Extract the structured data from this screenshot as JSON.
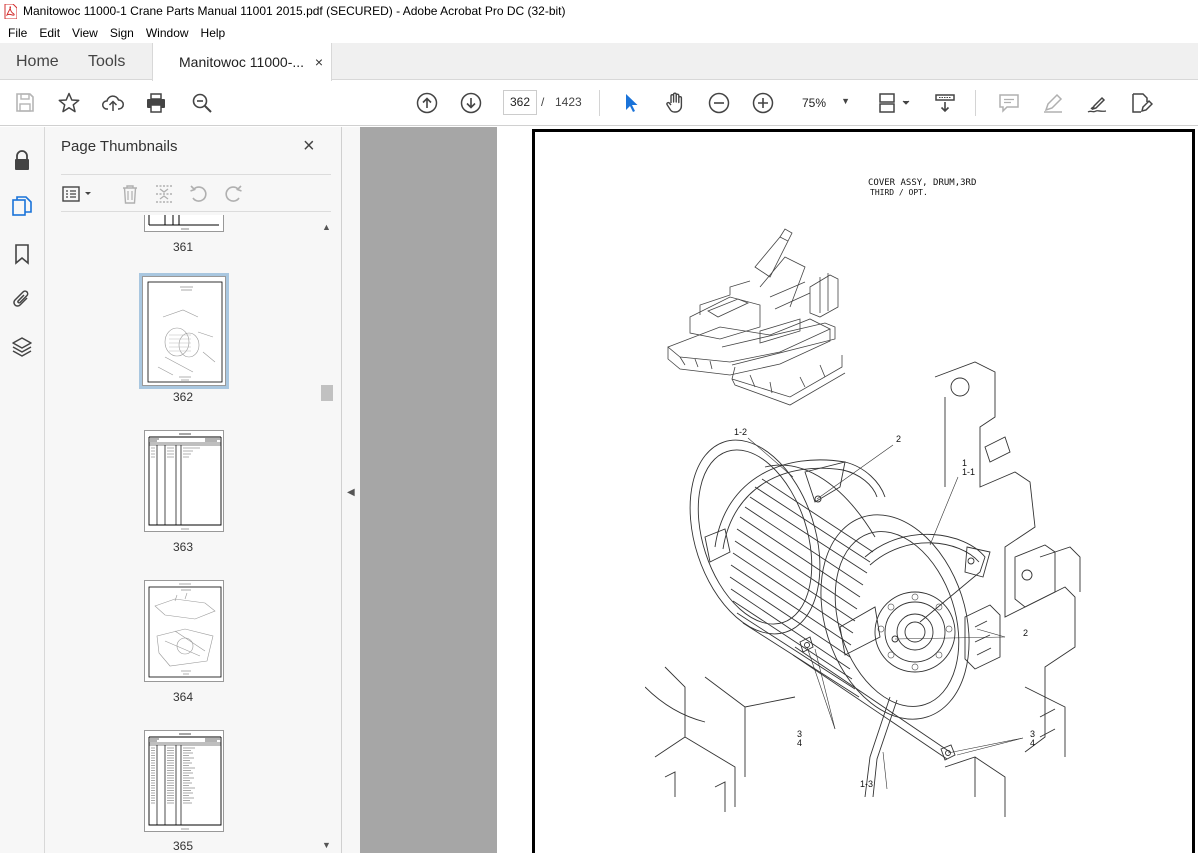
{
  "window": {
    "title": "Manitowoc 11000-1 Crane Parts Manual 11001 2015.pdf (SECURED) - Adobe Acrobat Pro DC (32-bit)"
  },
  "menu": [
    "File",
    "Edit",
    "View",
    "Sign",
    "Window",
    "Help"
  ],
  "tabs": {
    "home": "Home",
    "tools": "Tools",
    "document": "Manitowoc 11000-...",
    "close": "×"
  },
  "toolbar": {
    "current_page": "362",
    "separator": "/",
    "total_pages": "1423",
    "zoom": "75%"
  },
  "thumb_panel": {
    "title": "Page Thumbnails",
    "close": "×",
    "pages": [
      {
        "label": "361"
      },
      {
        "label": "362",
        "selected": true
      },
      {
        "label": "363"
      },
      {
        "label": "364"
      },
      {
        "label": "365"
      }
    ]
  },
  "page_content": {
    "title_line1": "COVER ASSY, DRUM,3RD",
    "title_line2": "THIRD / OPT.",
    "callouts": [
      {
        "text": "1-2"
      },
      {
        "text": "2"
      },
      {
        "text": "1"
      },
      {
        "text": "1-1"
      },
      {
        "text": "2"
      },
      {
        "text": "3"
      },
      {
        "text": "4"
      },
      {
        "text": "3"
      },
      {
        "text": "4"
      },
      {
        "text": "1-3"
      }
    ]
  },
  "colors": {
    "accent_blue": "#1a73d9",
    "gray_bg": "#a6a6a6",
    "panel_bg": "#f7f7f7",
    "selection": "#a9c7e0"
  }
}
